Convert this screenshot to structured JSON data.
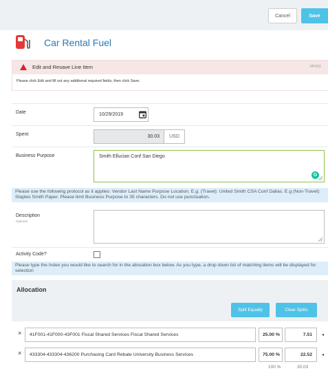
{
  "toolbar": {
    "cancel_label": "Cancel",
    "save_label": "Save"
  },
  "header": {
    "title": "Car Rental Fuel",
    "icon": "fuel-pump-icon"
  },
  "alert": {
    "title": "Edit and Resave Line Item",
    "code": "#PX01",
    "message": "Please click Edit and fill out any additional required fields, then click Save."
  },
  "fields": {
    "date": {
      "label": "Date",
      "value": "10/29/2019"
    },
    "spent": {
      "label": "Spent",
      "value": "30.03",
      "currency": "USD"
    },
    "purpose": {
      "label": "Business Purpose",
      "value": "Smith Ellucian Conf San Diego"
    },
    "purpose_help": "Please use the following protocol as it applies: Vendor Last Name Purpose Location. E.g. (Travel): United Smith CSA Conf Dallas. E.g (Non-Travel): Staples Smith Paper. Please limit Business Purpose to 35 characters. Do not use punctuation.",
    "description": {
      "label": "Description",
      "sublabel": "Optional",
      "value": ""
    },
    "activity": {
      "label": "Activity Code?"
    },
    "index_help": "Please type the Index you would like to search for in the allocation box below. As you type, a drop down list of matching items will be displayed for selection"
  },
  "allocation": {
    "title": "Allocation",
    "split_equally_label": "Split Equally",
    "clear_splits_label": "Clear Splits",
    "rows": [
      {
        "remove": "×",
        "account": "41F001-41F000-43F001 Fiscal Shared Services Fiscal Shared Services",
        "percent": "25.00 %",
        "amount": "7.51",
        "caret": "◂"
      },
      {
        "remove": "×",
        "account": "433304-433304-436200 Purchasing Card Rebate University Business Services",
        "percent": "75.00 %",
        "amount": "22.52",
        "caret": "◂"
      }
    ],
    "total_percent": "100 %",
    "total_amount": "30.03"
  },
  "colors": {
    "accent": "#4fc2e8",
    "title_blue": "#2a78b7",
    "alert_red": "#d9262b",
    "info_bg": "#ddeefa"
  }
}
